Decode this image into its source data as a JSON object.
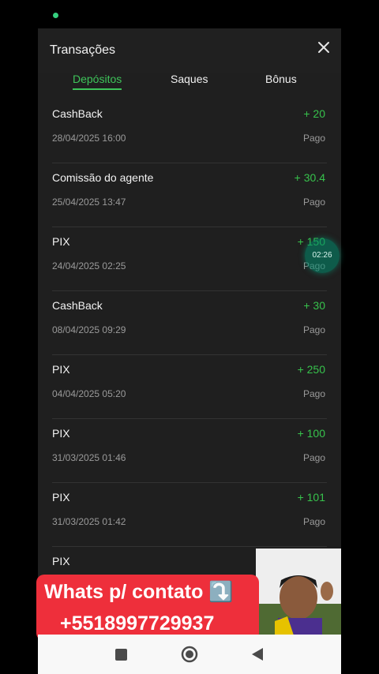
{
  "modal": {
    "title": "Transações"
  },
  "tabs": [
    {
      "label": "Depósitos",
      "active": true
    },
    {
      "label": "Saques",
      "active": false
    },
    {
      "label": "Bônus",
      "active": false
    }
  ],
  "transactions": [
    {
      "name": "CashBack",
      "amount": "+ 20",
      "date": "28/04/2025 16:00",
      "status": "Pago"
    },
    {
      "name": "Comissão do agente",
      "amount": "+ 30.4",
      "date": "25/04/2025 13:47",
      "status": "Pago"
    },
    {
      "name": "PIX",
      "amount": "+ 150",
      "date": "24/04/2025 02:25",
      "status": "Pago"
    },
    {
      "name": "CashBack",
      "amount": "+ 30",
      "date": "08/04/2025 09:29",
      "status": "Pago"
    },
    {
      "name": "PIX",
      "amount": "+ 250",
      "date": "04/04/2025 05:20",
      "status": "Pago"
    },
    {
      "name": "PIX",
      "amount": "+ 100",
      "date": "31/03/2025 01:46",
      "status": "Pago"
    },
    {
      "name": "PIX",
      "amount": "+ 101",
      "date": "31/03/2025 01:42",
      "status": "Pago"
    },
    {
      "name": "PIX",
      "amount": "",
      "date": "",
      "status": ""
    }
  ],
  "floating_timer": "02:26",
  "promo": {
    "line1": "Whats p/ contato ⤵️",
    "line2": "+5518997729937"
  },
  "colors": {
    "accent": "#3ec45a",
    "amount": "#37c24c",
    "banner": "#ee2f3b"
  },
  "icons": {
    "close": "close-icon",
    "recents": "square-icon",
    "home": "circle-icon",
    "back": "triangle-back-icon"
  }
}
